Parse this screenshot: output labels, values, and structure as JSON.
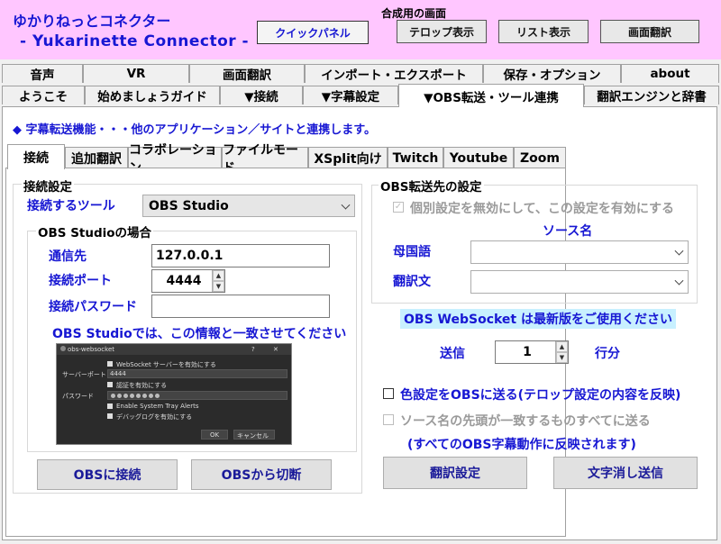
{
  "header": {
    "title_line1": "ゆかりねっとコネクター",
    "title_line2": "- Yukarinette Connector -",
    "quick_panel": "クイックパネル",
    "compose_label": "合成用の画面",
    "telop_button": "テロップ表示",
    "list_button": "リスト表示",
    "screen_translate_button": "画面翻訳"
  },
  "main_tabs_row1": [
    "音声",
    "VR",
    "画面翻訳",
    "インポート・エクスポート",
    "保存・オプション",
    "about"
  ],
  "main_tabs_row2": [
    "ようこそ",
    "始めましょうガイド",
    "▼接続",
    "▼字幕設定",
    "▼OBS転送・ツール連携",
    "翻訳エンジンと辞書"
  ],
  "subtitle": "◆ 字幕転送機能・・・他のアプリケーション／サイトと連携します。",
  "sub_tabs": [
    "接続",
    "追加翻訳",
    "コラボレーション",
    "ファイルモード",
    "XSplit向け",
    "Twitch",
    "Youtube",
    "Zoom"
  ],
  "connection": {
    "group_label": "接続設定",
    "tool_label": "接続するツール",
    "tool_value": "OBS Studio",
    "obs_group_label": "OBS Studioの場合",
    "host_label": "通信先",
    "host_value": "127.0.0.1",
    "port_label": "接続ポート",
    "port_value": "4444",
    "password_label": "接続パスワード",
    "password_value": "",
    "match_note": "OBS Studioでは、この情報と一致させてください",
    "connect_button": "OBSに接続",
    "disconnect_button": "OBSから切断"
  },
  "mini_screenshot": {
    "title": "obs-websocket",
    "help": "?",
    "close": "✕",
    "row1": "WebSocket サーバーを有効にする",
    "port_label": "サーバーポート",
    "port_value": "4444",
    "row3": "認証を有効にする",
    "password_label": "パスワード",
    "row5": "Enable System Tray Alerts",
    "row6": "デバッグログを有効にする",
    "ok": "OK",
    "cancel": "キャンセル"
  },
  "obs_target": {
    "group_label": "OBS転送先の設定",
    "override_label": "個別設定を無効にして、この設定を有効にする",
    "source_name_header": "ソース名",
    "native_label": "母国語",
    "native_value": "",
    "translation_label": "翻訳文",
    "translation_value": ""
  },
  "websocket_note": "OBS WebSocket は最新版をご使用ください",
  "send": {
    "label": "送信",
    "value": "1",
    "unit": "行分"
  },
  "options": {
    "color_label": "色設定をOBSに送る(テロップ設定の内容を反映)",
    "prefix_label": "ソース名の先頭が一致するものすべてに送る",
    "prefix_note": "(すべてのOBS字幕動作に反映されます)"
  },
  "buttons": {
    "translate_settings": "翻訳設定",
    "clear_send": "文字消し送信"
  }
}
